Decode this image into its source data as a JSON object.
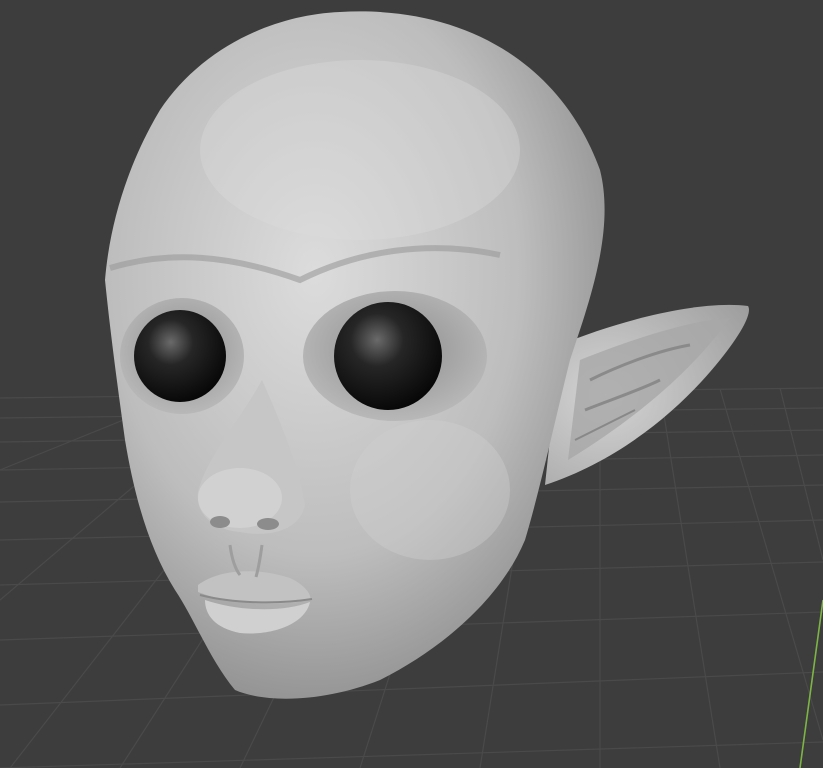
{
  "viewport": {
    "background_color": "#3d3d3d",
    "grid_line_color": "#4a4a4a",
    "y_axis_color": "#7db545",
    "mesh_color": "#c4c4c4",
    "eye_color": "#141414"
  }
}
